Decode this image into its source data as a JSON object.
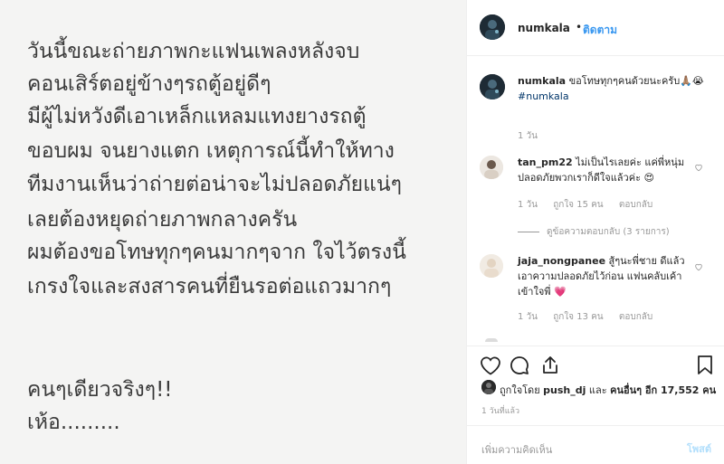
{
  "post": {
    "lines": [
      "วันนี้ขณะถ่ายภาพกะแฟนเพลงหลังจบ",
      "คอนเสิร์ตอยู่ข้างๆรถตู้อยู่ดีๆ",
      "มีผู้ไม่หวังดีเอาเหล็กแหลมแทงยางรถตู้",
      "ขอบผม จนยางแตก เหตุการณ์นี้ทำให้ทาง",
      "ทีมงานเห็นว่าถ่ายต่อน่าจะไม่ปลอดภัยแน่ๆ",
      "เลยต้องหยุดถ่ายภาพกลางครัน",
      "ผมต้องขอโทษทุกๆคนมากๆจาก ใจไว้ตรงนี้",
      "เกรงใจและสงสารคนที่ยืนรอต่อแถวมากๆ",
      "คนๆเดียวจริงๆ!!",
      "เห้อ........."
    ]
  },
  "header": {
    "username": "numkala",
    "separator": "•",
    "follow_label": "ติดตาม"
  },
  "caption": {
    "username": "numkala",
    "text": "ขอโทษทุกๆคนด้วยนะครับ🙏🏽😭",
    "hashtag": "#numkala",
    "time": "1 วัน"
  },
  "comments": [
    {
      "username": "tan_pm22",
      "text": "ไม่เป็นไรเลยค่ะ แค่พี่หนุ่มปลอดภัยพวกเราก็ดีใจแล้วค่ะ 😍",
      "time": "1 วัน",
      "likes": "ถูกใจ 15 คน",
      "reply": "ตอบกลับ"
    },
    {
      "username": "jaja_nongpanee",
      "text": "สู้ๆนะพี่ชาย ดีแล้วเอาความปลอดภัยไว้ก่อน แฟนคลับเค้าเข้าใจพี่ 💗",
      "time": "1 วัน",
      "likes": "ถูกใจ 13 คน",
      "reply": "ตอบกลับ"
    }
  ],
  "view_replies": "ดูข้อความตอบกลับ (3 รายการ)",
  "likes_summary": {
    "prefix": "ถูกใจโดย",
    "user": "push_dj",
    "middle": "และ",
    "others": "คนอื่นๆ อีก 17,552 คน"
  },
  "time_ago": "1 วันที่แล้ว",
  "add_comment": {
    "placeholder": "เพิ่มความคิดเห็น",
    "post_label": "โพสต์"
  },
  "colors": {
    "link_blue": "#3897f0",
    "post_button_disabled": "#b2dffc",
    "image_bg": "#f4f4f3"
  },
  "icons": [
    "heart-icon",
    "comment-icon",
    "share-icon",
    "bookmark-icon",
    "small-heart-icon"
  ]
}
